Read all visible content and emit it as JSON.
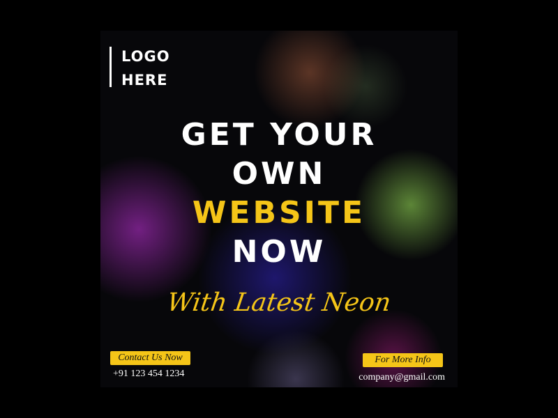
{
  "logo": {
    "line1": "LOGO",
    "line2": "HERE"
  },
  "headline": {
    "line1": "GET YOUR",
    "line2": "OWN",
    "line3": "WEBSITE",
    "line4": "NOW"
  },
  "tagline": "With Latest Neon",
  "contact": {
    "button_label": "Contact Us Now",
    "phone": "+91 123 454 1234"
  },
  "info": {
    "button_label": "For More Info",
    "email": "company@gmail.com"
  },
  "colors": {
    "accent": "#f5c518",
    "text": "#ffffff",
    "background": "#07070a"
  }
}
